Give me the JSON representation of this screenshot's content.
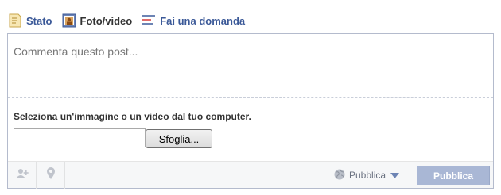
{
  "tabs": [
    {
      "label": "Stato",
      "icon": "status-note-icon",
      "active": false
    },
    {
      "label": "Foto/video",
      "icon": "photo-video-icon",
      "active": true
    },
    {
      "label": "Fai una domanda",
      "icon": "question-poll-icon",
      "active": false
    }
  ],
  "composer": {
    "placeholder": "Commenta questo post...",
    "upload_label": "Seleziona un'immagine o un video dal tuo computer.",
    "file_value": "",
    "browse_label": "Sfoglia..."
  },
  "footer": {
    "tag_icon": "add-person-icon",
    "location_icon": "location-pin-icon",
    "audience_icon": "globe-icon",
    "audience_label": "Pubblica",
    "post_label": "Pubblica"
  },
  "colors": {
    "link_blue": "#3b5998",
    "post_button_disabled": "#a9b7d5",
    "border": "#b4bbcd"
  }
}
